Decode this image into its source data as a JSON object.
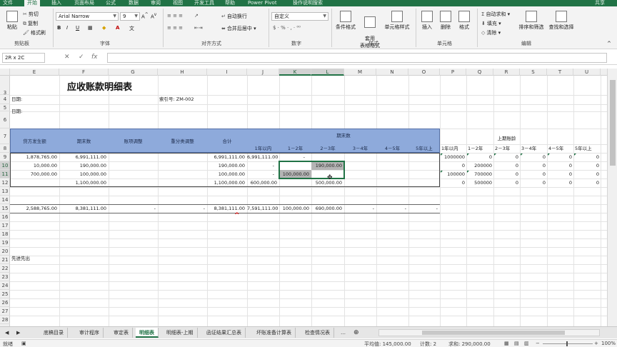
{
  "menubar": {
    "tabs": [
      "文件",
      "开始",
      "插入",
      "页面布局",
      "公式",
      "数据",
      "审阅",
      "视图",
      "开发工具",
      "帮助",
      "Power Pivot",
      "操作说明搜索"
    ],
    "active": "开始",
    "share": "共享"
  },
  "ribbon": {
    "clipboard": {
      "paste": "粘贴",
      "cut": "剪切",
      "copy": "复制",
      "format_painter": "格式刷",
      "label": "剪贴板"
    },
    "font": {
      "name": "Arial Narrow",
      "size": "9",
      "bold": "B",
      "italic": "I",
      "underline": "U",
      "label": "字体"
    },
    "alignment": {
      "wrap": "自动换行",
      "merge": "合并后居中",
      "label": "对齐方式"
    },
    "number": {
      "format": "自定义",
      "label": "数字"
    },
    "styles": {
      "conditional": "条件格式",
      "table": "套用\n表格格式",
      "cell_styles": "单元格样式",
      "label": "样式"
    },
    "cells": {
      "insert": "插入",
      "delete": "删除",
      "format": "格式",
      "label": "单元格"
    },
    "editing": {
      "autosum": "自动求和",
      "fill": "填充",
      "clear": "清除",
      "sort": "排序和筛选",
      "find": "查找和选择",
      "label": "编辑"
    }
  },
  "formula_bar": {
    "name_box": "2R x 2C",
    "value": ""
  },
  "columns": [
    "E",
    "F",
    "G",
    "H",
    "I",
    "J",
    "K",
    "L",
    "M",
    "N",
    "O",
    "P",
    "Q",
    "R",
    "S",
    "T",
    "U"
  ],
  "rows": [
    "3",
    "4",
    "5",
    "6",
    "7",
    "8",
    "9",
    "10",
    "11",
    "12",
    "13",
    "14",
    "15",
    "16",
    "17",
    "18",
    "19",
    "20",
    "21",
    "22",
    "23",
    "24",
    "25",
    "26",
    "27",
    "28"
  ],
  "sheet": {
    "title": "应收账款明细表",
    "date_label": "日期:",
    "date_label2": "日期:",
    "index_label": "索引号: ZM-002",
    "headers": {
      "amount": "贷方发生额",
      "ending": "期末数",
      "adjust": "账项调整",
      "reclass": "重分类调整",
      "total": "合计",
      "ending_group": "期末数",
      "aging": [
        "1年以内",
        "1－2年",
        "2－3年",
        "3－4年",
        "4－5年",
        "5年以上"
      ]
    },
    "rows": [
      {
        "E": "1,878,765.00",
        "F": "6,991,111.00",
        "G": "",
        "H": "",
        "I": "6,991,111.00",
        "J": "6,991,111.00",
        "K": "-",
        "L": ""
      },
      {
        "E": "10,000.00",
        "F": "190,000.00",
        "G": "",
        "H": "",
        "I": "190,000.00",
        "J": "-",
        "K": "",
        "L": "190,000.00"
      },
      {
        "E": "700,000.00",
        "F": "100,000.00",
        "G": "",
        "H": "",
        "I": "100,000.00",
        "J": "-",
        "K": "100,000.00",
        "L": ""
      },
      {
        "E": "",
        "F": "1,100,000.00",
        "G": "",
        "H": "",
        "I": "1,100,000.00",
        "J": "600,000.00",
        "K": "",
        "L": "500,000.00"
      }
    ],
    "totals": {
      "E": "2,588,765.00",
      "F": "8,381,111.00",
      "G": "-",
      "H": "-",
      "I": "8,381,111.00",
      "J": "7,591,111.00",
      "K": "100,000.00",
      "L": "690,000.00",
      "M": "-",
      "N": "-",
      "O": "-"
    },
    "caret": "^",
    "note": "先进先出",
    "prior": {
      "title": "上期账龄",
      "headers": [
        "1年以内",
        "1－2年",
        "2－3年",
        "3－4年",
        "4－5年",
        "5年以上"
      ],
      "rows": [
        [
          "1000000",
          "0",
          "0",
          "0",
          "0",
          "0"
        ],
        [
          "0",
          "200000",
          "0",
          "0",
          "0",
          "0"
        ],
        [
          "100000",
          "700000",
          "0",
          "0",
          "0",
          "0"
        ],
        [
          "0",
          "500000",
          "0",
          "0",
          "0",
          "0"
        ]
      ]
    }
  },
  "tabs": [
    "底稿目录",
    "审计程序",
    "审定表",
    "明细表",
    "明细表-上期",
    "函证结果汇总表",
    "坏账准备计算表",
    "检查情况表"
  ],
  "active_tab": "明细表",
  "status": {
    "mode": "就绪",
    "average": "平均值: 145,000.00",
    "count": "计数: 2",
    "sum": "求和: 290,000.00",
    "zoom": "100%"
  }
}
